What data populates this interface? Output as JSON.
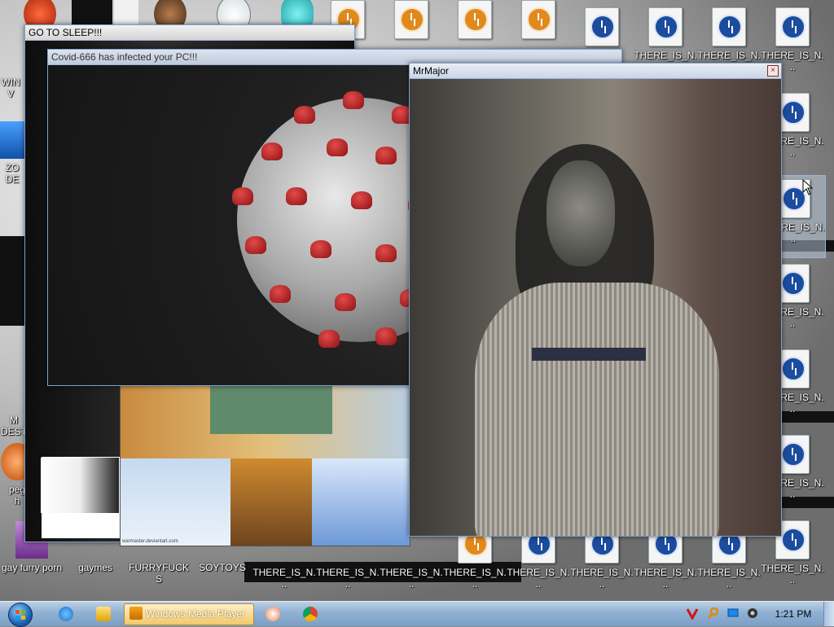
{
  "desktop": {
    "icons_top": [
      {
        "label": "",
        "kind": "generic"
      },
      {
        "label": "",
        "kind": "orange"
      },
      {
        "label": "",
        "kind": "orange"
      },
      {
        "label": "",
        "kind": "orange"
      },
      {
        "label": "",
        "kind": "orange"
      },
      {
        "label": "",
        "kind": "file"
      },
      {
        "label": "",
        "kind": "file"
      },
      {
        "label": "",
        "kind": "file"
      },
      {
        "label": "",
        "kind": "file"
      }
    ],
    "there_is_label": "THERE_IS_N...",
    "left_partial": [
      "WIN",
      "V",
      "ZO",
      "DE",
      "M",
      "DEST",
      "peg",
      "h"
    ],
    "bottom_icons": [
      {
        "label": "gay furry porn"
      },
      {
        "label": "gaymes"
      },
      {
        "label": "FURRYFUCKS"
      },
      {
        "label": "SOYTOYS"
      }
    ]
  },
  "windows": {
    "sleep": {
      "title": "GO TO SLEEP!!!"
    },
    "covid": {
      "title": "Covid-666 has infected your PC!!!"
    },
    "major": {
      "title": "MrMajor",
      "close_glyph": "×"
    }
  },
  "collage": {
    "watermark": "warmaster.deviantart.com"
  },
  "taskbar": {
    "active_task": "Windows Media Player",
    "clock": "1:21 PM",
    "icons": [
      "start-orb-icon",
      "ie-icon",
      "explorer-icon",
      "media-player-icon",
      "bug-icon",
      "chrome-icon"
    ],
    "tray_icons": [
      "antivirus-v-icon",
      "search-magnifier-icon",
      "network-monitor-icon",
      "speaker-icon"
    ]
  },
  "colors": {
    "taskbar": "#8fb0d2",
    "active_task": "#f2c86a",
    "virus_spike": "#b71c1c",
    "title_bar": "#c9d6e8"
  }
}
